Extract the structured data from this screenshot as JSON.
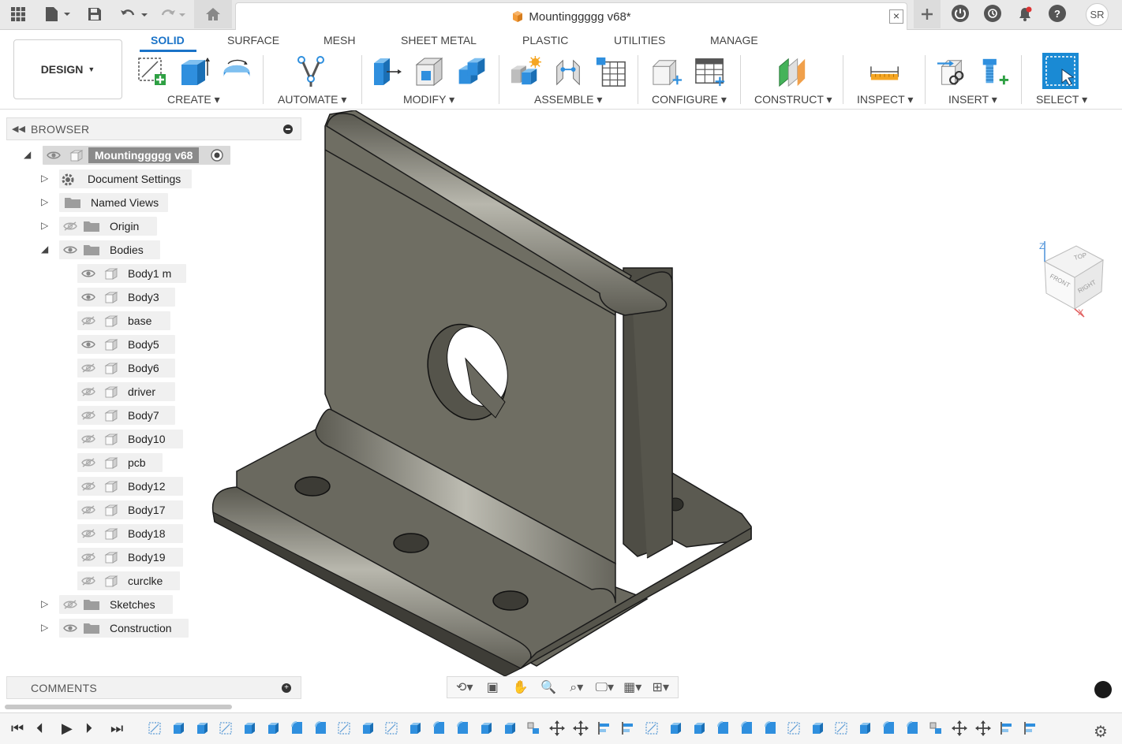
{
  "topbar": {
    "doc_title": "Mountinggggg v68*",
    "user_initials": "SR"
  },
  "workspace": {
    "design_label": "DESIGN",
    "tabs": [
      "SOLID",
      "SURFACE",
      "MESH",
      "SHEET METAL",
      "PLASTIC",
      "UTILITIES",
      "MANAGE"
    ],
    "active_tab": "SOLID",
    "groups": [
      "CREATE",
      "AUTOMATE",
      "MODIFY",
      "ASSEMBLE",
      "CONFIGURE",
      "CONSTRUCT",
      "INSPECT",
      "INSERT",
      "SELECT"
    ]
  },
  "browser": {
    "title": "BROWSER",
    "root": "Mountinggggg v68",
    "folders": [
      "Document Settings",
      "Named Views",
      "Origin",
      "Bodies"
    ],
    "bodies": [
      "Body1 m",
      "Body3",
      "base",
      "Body5",
      "Body6",
      "driver",
      "Body7",
      "Body10",
      "pcb",
      "Body12",
      "Body17",
      "Body18",
      "Body19",
      "curclke"
    ],
    "tail_folders": [
      "Sketches",
      "Construction"
    ]
  },
  "comments": {
    "title": "COMMENTS"
  },
  "viewcube": {
    "top": "TOP",
    "front": "FRONT",
    "right": "RIGHT",
    "z_axis": "Z",
    "x_axis": "X"
  },
  "colors": {
    "accent": "#1a73c8",
    "model_face": "#6e6d62",
    "model_dark": "#4d4c44"
  }
}
